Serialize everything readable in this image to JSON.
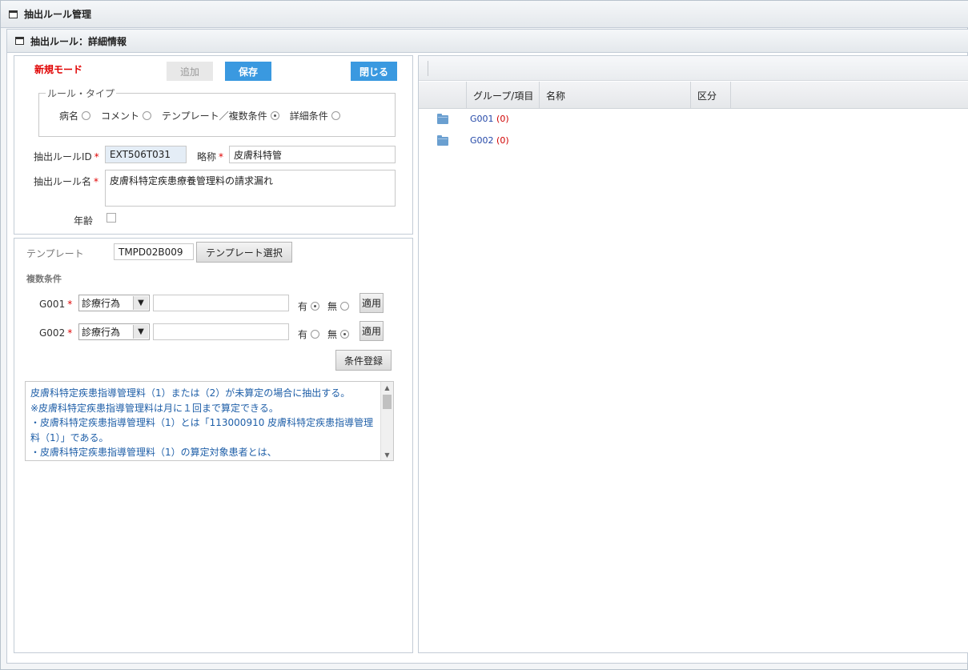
{
  "window": {
    "title": "抽出ルール管理"
  },
  "panel": {
    "title": "抽出ルール：詳細情報"
  },
  "form": {
    "mode": "新規モード",
    "add_label": "追加",
    "save_label": "保存",
    "close_label": "閉じる",
    "rule_type_legend": "ルール・タイプ",
    "rule_types": [
      {
        "label": "病名",
        "selected": false
      },
      {
        "label": "コメント",
        "selected": false
      },
      {
        "label": "テンプレート／複数条件",
        "selected": true
      },
      {
        "label": "詳細条件",
        "selected": false
      }
    ],
    "rule_id_label": "抽出ルールID",
    "rule_id_value": "EXT506T031",
    "short_name_label": "略称",
    "short_name_value": "皮膚科特管",
    "rule_name_label": "抽出ルール名",
    "rule_name_value": "皮膚科特定疾患療養管理料の請求漏れ",
    "age_label": "年齢",
    "required_mark": "*"
  },
  "template_section": {
    "template_label": "テンプレート",
    "template_value": "TMPD02B009",
    "template_select_label": "テンプレート選択",
    "multi_condition_label": "複数条件",
    "conditions": [
      {
        "id": "G001",
        "select_value": "診療行為",
        "input_value": "",
        "yes_label": "有",
        "no_label": "無",
        "selected": "yes",
        "apply_label": "適用"
      },
      {
        "id": "G002",
        "select_value": "診療行為",
        "input_value": "",
        "yes_label": "有",
        "no_label": "無",
        "selected": "no",
        "apply_label": "適用"
      }
    ],
    "register_label": "条件登録",
    "description_lines": [
      "皮膚科特定疾患指導管理料（1）または（2）が未算定の場合に抽出する。",
      "※皮膚科特定疾患指導管理料は月に１回まで算定できる。",
      "・皮膚科特定疾患指導管理料（1）とは「113000910 皮膚科特定疾患指導管理",
      "料（1）」である。",
      "・皮膚科特定疾患指導管理料（1）の算定対象患者とは、"
    ]
  },
  "grid": {
    "columns": [
      "グループ/項目",
      "名称",
      "区分"
    ],
    "nodes": [
      {
        "code": "G001",
        "count": "(0)"
      },
      {
        "code": "G002",
        "count": "(0)"
      }
    ]
  }
}
